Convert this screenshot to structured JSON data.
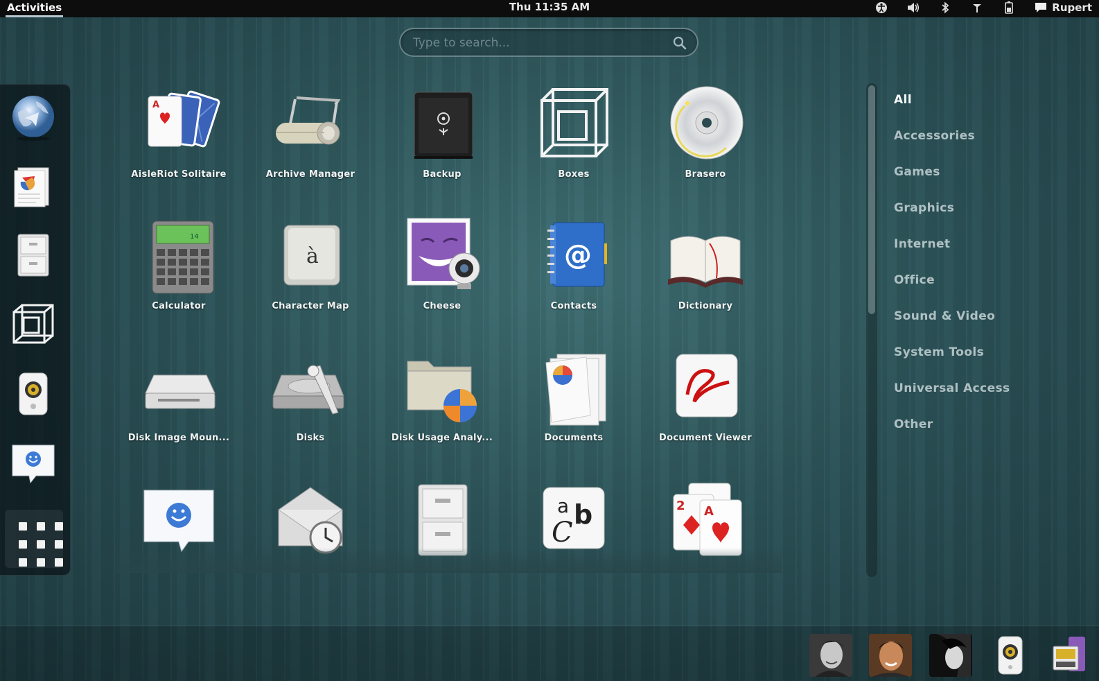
{
  "topbar": {
    "activities": "Activities",
    "clock": "Thu 11:35 AM",
    "user": "Rupert",
    "status_icons": [
      "accessibility-icon",
      "volume-icon",
      "bluetooth-icon",
      "network-icon",
      "battery-icon",
      "chat-icon"
    ]
  },
  "search": {
    "placeholder": "Type to search..."
  },
  "dash": {
    "items": [
      "web-browser",
      "documents",
      "file-cabinet",
      "boxes",
      "speaker",
      "empathy-chat"
    ]
  },
  "apps": [
    {
      "label": "AisleRiot Solitaire",
      "icon": "cards-icon"
    },
    {
      "label": "Archive Manager",
      "icon": "archive-icon"
    },
    {
      "label": "Backup",
      "icon": "safe-icon"
    },
    {
      "label": "Boxes",
      "icon": "boxes-icon"
    },
    {
      "label": "Brasero",
      "icon": "disc-icon"
    },
    {
      "label": "Calculator",
      "icon": "calculator-icon"
    },
    {
      "label": "Character Map",
      "icon": "character-key-icon"
    },
    {
      "label": "Cheese",
      "icon": "webcam-icon"
    },
    {
      "label": "Contacts",
      "icon": "address-book-icon"
    },
    {
      "label": "Dictionary",
      "icon": "book-icon"
    },
    {
      "label": "Disk Image Moun...",
      "icon": "disk-drive-icon"
    },
    {
      "label": "Disks",
      "icon": "hard-disk-icon"
    },
    {
      "label": "Disk Usage Analy...",
      "icon": "folder-chart-icon"
    },
    {
      "label": "Documents",
      "icon": "documents-icon"
    },
    {
      "label": "Document Viewer",
      "icon": "document-viewer-icon"
    },
    {
      "label": "",
      "icon": "chat-bubble-icon"
    },
    {
      "label": "",
      "icon": "mail-clock-icon"
    },
    {
      "label": "",
      "icon": "cabinet-icon"
    },
    {
      "label": "",
      "icon": "fonts-icon"
    },
    {
      "label": "",
      "icon": "freecell-cards-icon"
    }
  ],
  "categories": [
    "All",
    "Accessories",
    "Games",
    "Graphics",
    "Internet",
    "Office",
    "Sound & Video",
    "System Tools",
    "Universal Access",
    "Other"
  ],
  "tray": {
    "items": [
      "contact-avatar-1",
      "contact-avatar-2",
      "contact-avatar-3",
      "speaker-icon",
      "notification-icon"
    ]
  }
}
